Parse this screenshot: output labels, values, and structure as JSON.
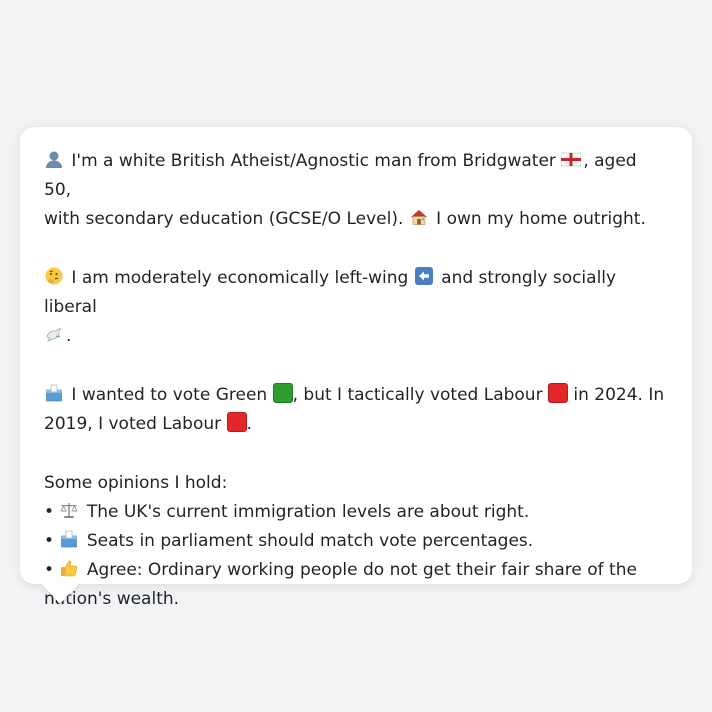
{
  "card": {
    "p1": {
      "a": "I'm a white British Atheist/Agnostic man from Bridgwater ",
      "b": ", aged 50,",
      "c": "with secondary education (GCSE/O Level). ",
      "d": " I own my home outright."
    },
    "p2": {
      "a": "I am moderately economically left-wing ",
      "b": " and strongly socially liberal",
      "c": "."
    },
    "p3": {
      "a": "I wanted to vote Green ",
      "b": ", but I tactically voted Labour ",
      "c": " in 2024. In",
      "d": "2019, I voted Labour ",
      "e": "."
    },
    "opinions": {
      "heading": "Some opinions I hold:",
      "bullet": "•",
      "items": [
        {
          "icon": "scales-icon",
          "text": "The UK's current immigration levels are about right."
        },
        {
          "icon": "ballot-box-icon",
          "text": "Seats in parliament should match vote percentages."
        },
        {
          "icon": "thumbs-up-icon",
          "text": "Agree: Ordinary working people do not get their fair share of the",
          "text2": "nation's wealth."
        }
      ]
    }
  },
  "colors": {
    "green": "#2e9e2f",
    "labour_red": "#e3262a",
    "background": "#f2f3f5"
  }
}
